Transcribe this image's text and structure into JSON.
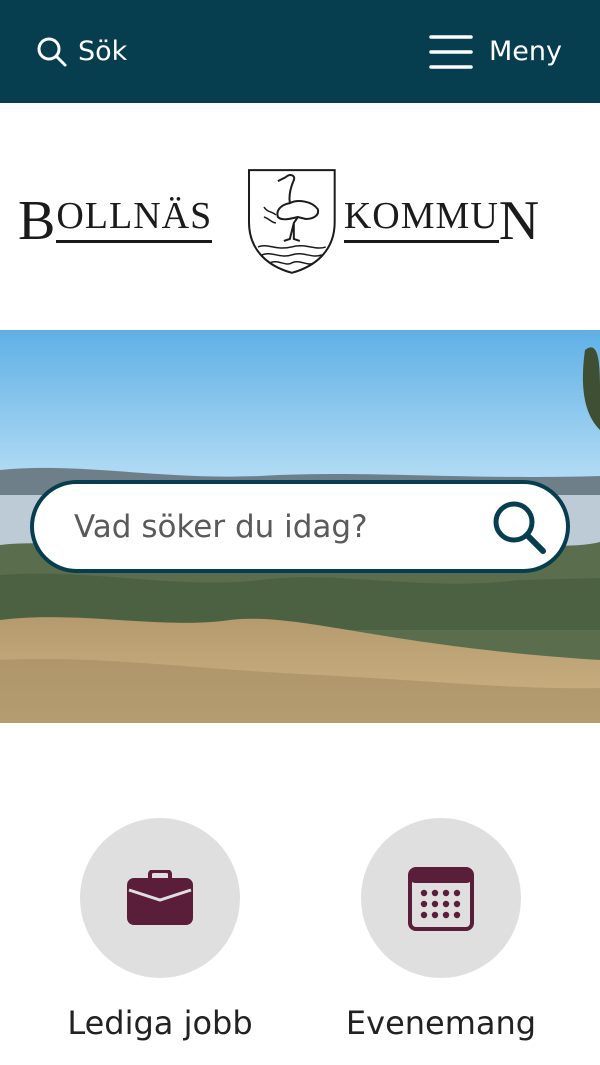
{
  "header": {
    "search_label": "Sök",
    "menu_label": "Meny",
    "background": "#063d4f"
  },
  "logo": {
    "left_initial": "B",
    "left_rest": "OLLNÄS",
    "right_rest": "KOMMU",
    "right_final": "N"
  },
  "hero": {
    "search_placeholder": "Vad söker du idag?"
  },
  "quick_links": [
    {
      "label": "Lediga jobb",
      "icon": "briefcase-icon"
    },
    {
      "label": "Evenemang",
      "icon": "calendar-icon"
    }
  ],
  "colors": {
    "accent": "#063d4f",
    "icon": "#5a1e3a",
    "circle": "#e0dfe0"
  }
}
